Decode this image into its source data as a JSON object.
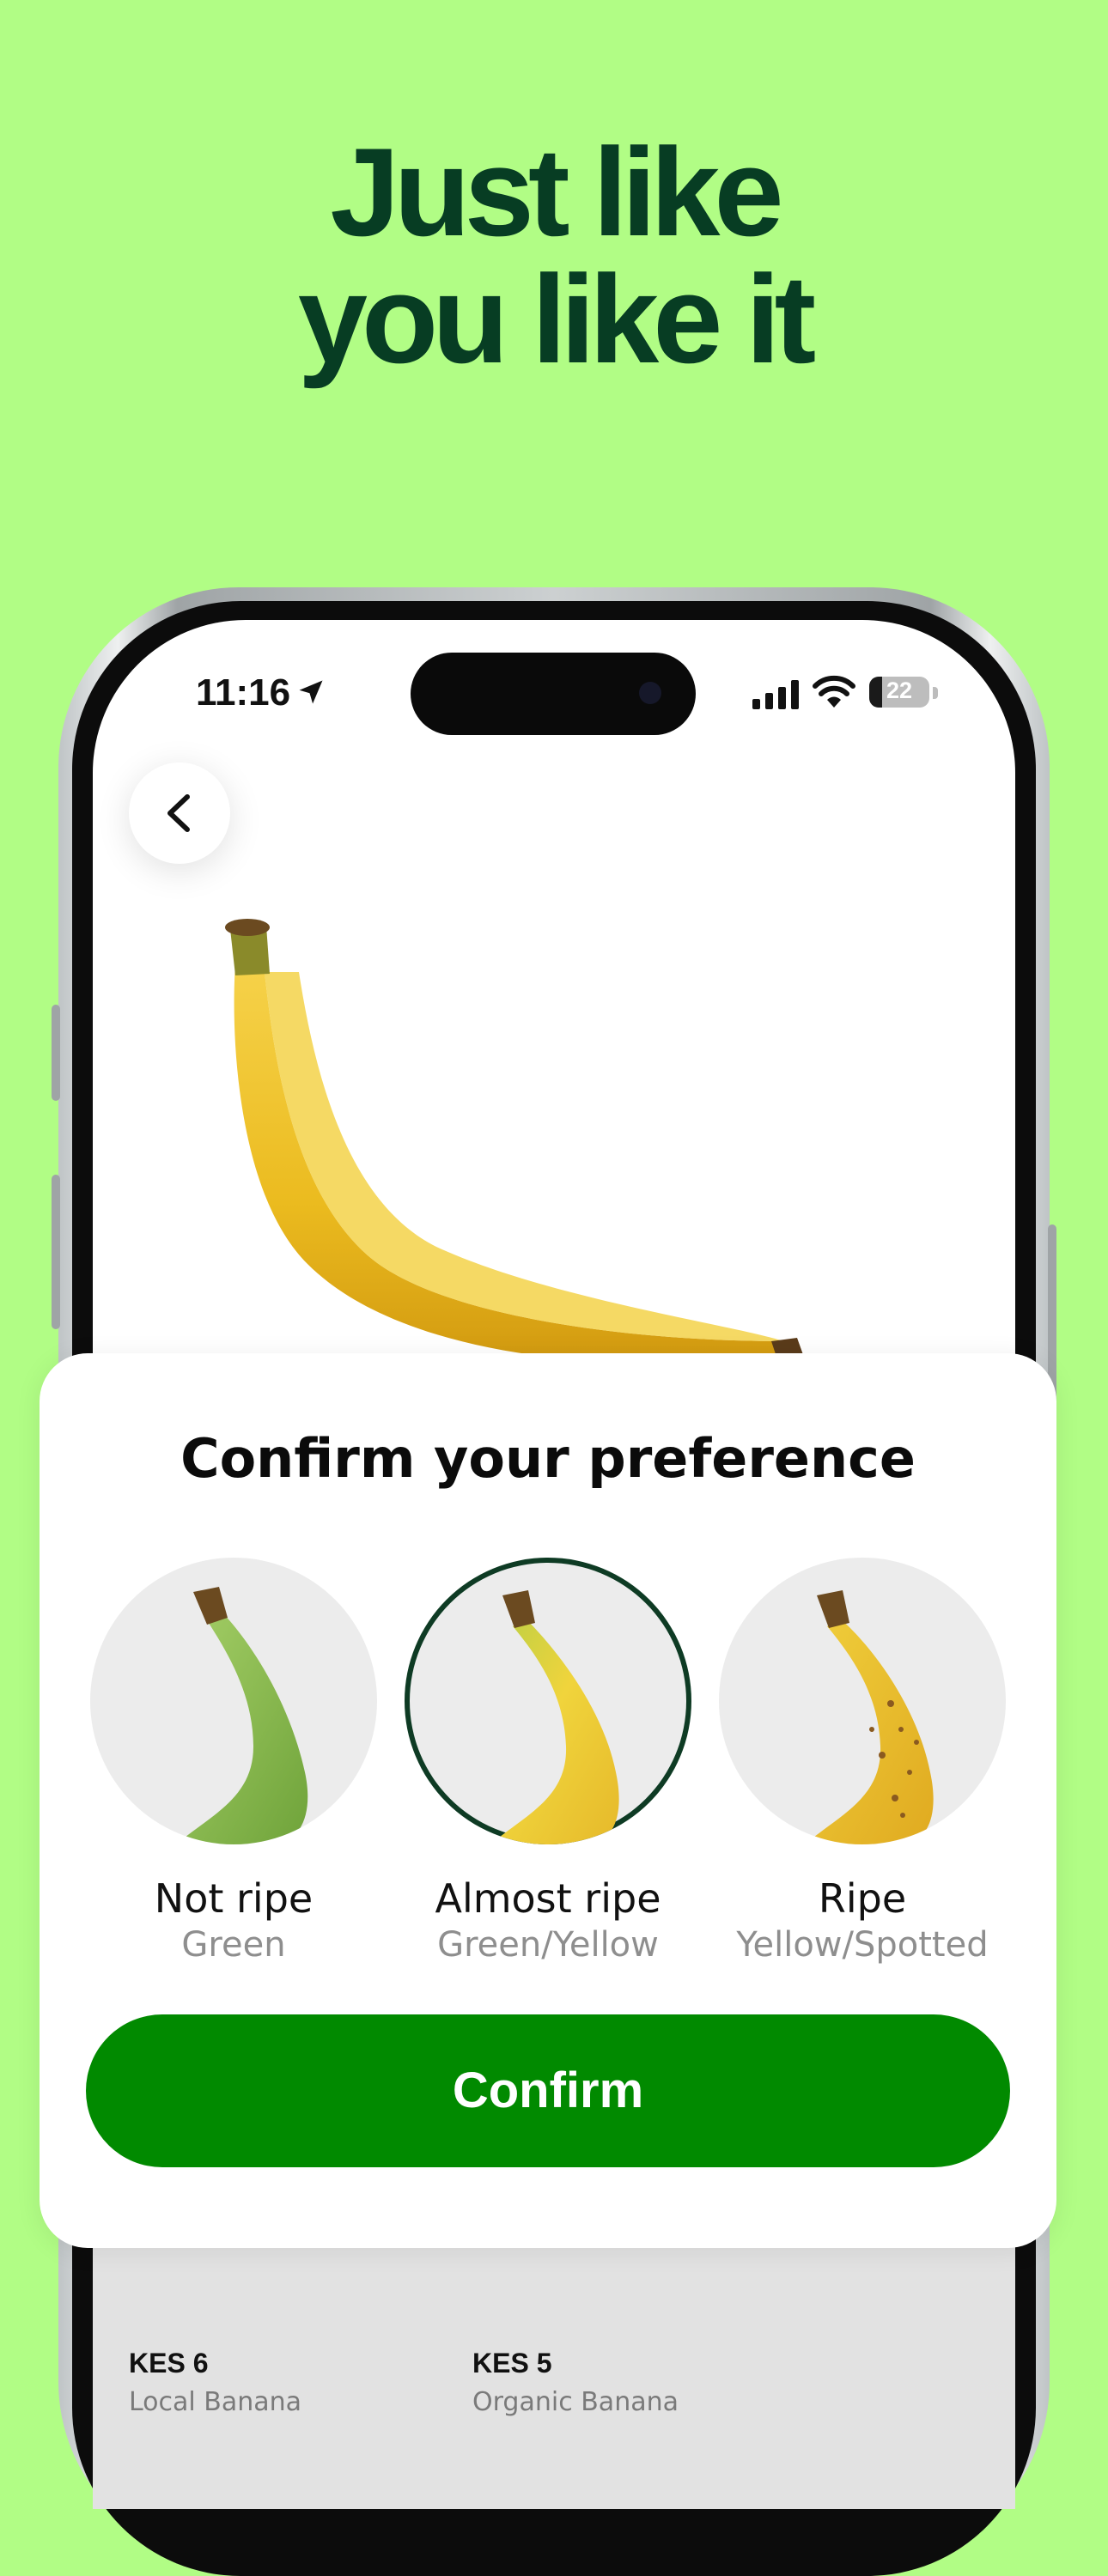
{
  "headline": {
    "line1": "Just like",
    "line2": "you like it"
  },
  "status_bar": {
    "time": "11:16",
    "battery": "22",
    "battery_level": 0.22
  },
  "sheet": {
    "title": "Confirm your preference",
    "options": [
      {
        "label": "Not ripe",
        "sub": "Green",
        "selected": false
      },
      {
        "label": "Almost ripe",
        "sub": "Green/Yellow",
        "selected": true
      },
      {
        "label": "Ripe",
        "sub": "Yellow/Spotted",
        "selected": false
      }
    ],
    "confirm_label": "Confirm"
  },
  "products": [
    {
      "price": "KES 6",
      "name": "Local Banana"
    },
    {
      "price": "KES 5",
      "name": "Organic Banana"
    }
  ],
  "colors": {
    "background": "#b1fd85",
    "headline": "#073d23",
    "confirm": "#018a00",
    "selected_ring": "#0e3b24"
  },
  "icons": [
    "location-arrow-icon",
    "signal-icon",
    "wifi-icon",
    "battery-icon",
    "back-chevron-icon"
  ]
}
